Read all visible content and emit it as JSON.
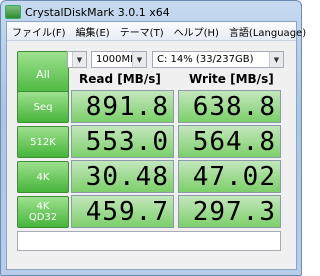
{
  "window": {
    "title": "CrystalDiskMark 3.0.1 x64"
  },
  "menu": [
    "ファイル(F)",
    "編集(E)",
    "テーマ(T)",
    "ヘルプ(H)",
    "言語(Language)"
  ],
  "controls": {
    "all_label": "All",
    "test_count": "5",
    "test_size": "1000MB",
    "drive": "C: 14% (33/237GB)"
  },
  "headers": {
    "read": "Read [MB/s]",
    "write": "Write [MB/s]"
  },
  "rows": [
    {
      "label": "Seq",
      "read": "891.8",
      "write": "638.8",
      "read_fill": 1.0,
      "write_fill": 1.0
    },
    {
      "label": "512K",
      "read": "553.0",
      "write": "564.8",
      "read_fill": 1.0,
      "write_fill": 1.0
    },
    {
      "label": "4K",
      "read": "30.48",
      "write": "47.02",
      "read_fill": 1.0,
      "write_fill": 1.0
    },
    {
      "label": "4K QD32",
      "read": "459.7",
      "write": "297.3",
      "read_fill": 1.0,
      "write_fill": 1.0
    }
  ],
  "comment": ""
}
